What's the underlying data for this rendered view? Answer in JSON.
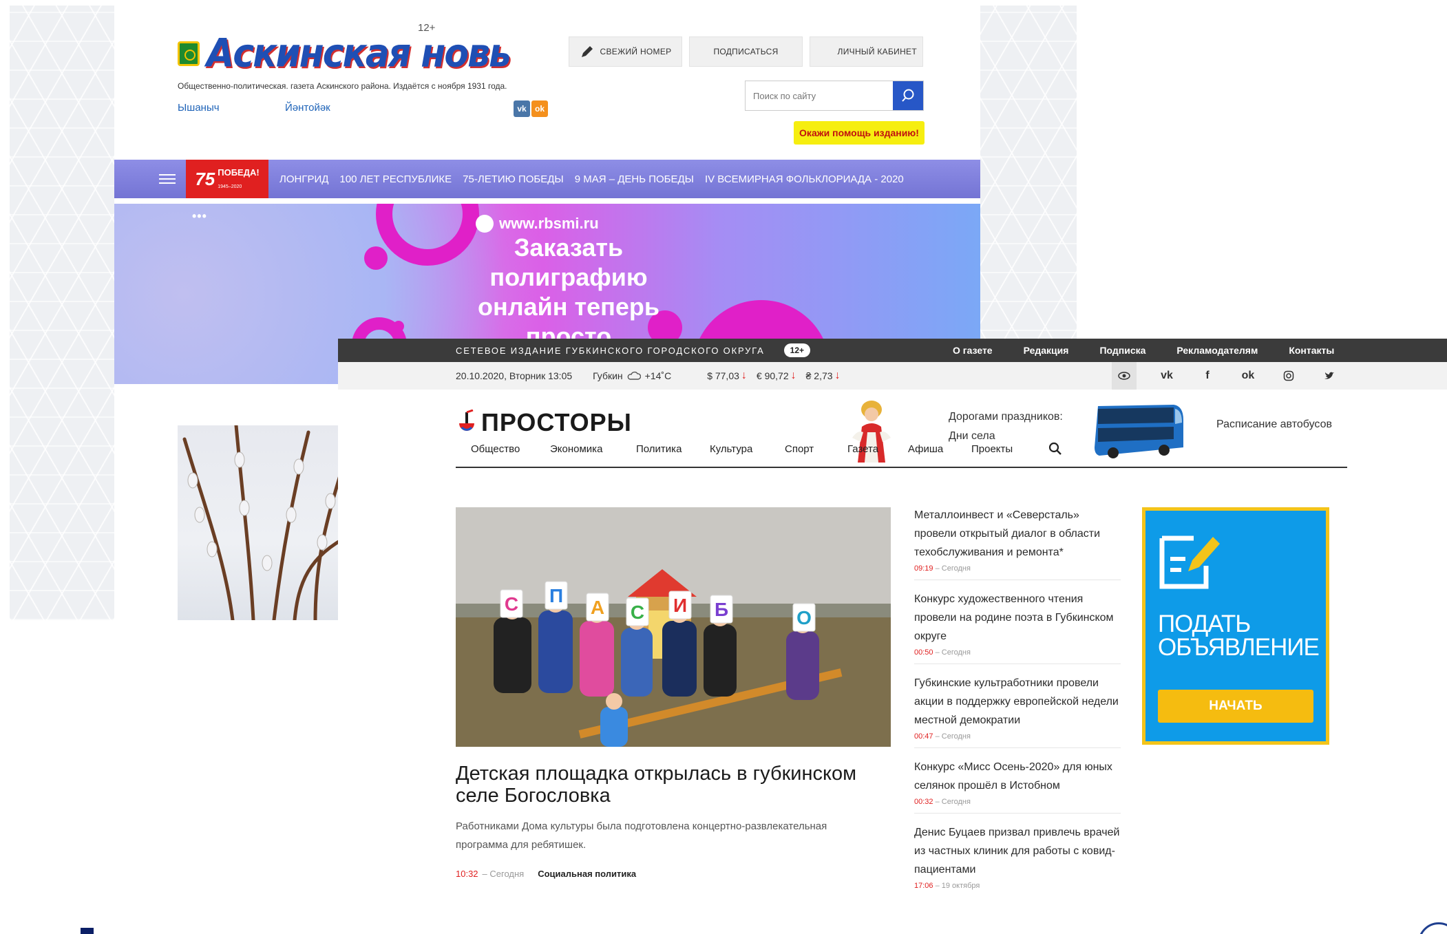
{
  "askinskaya": {
    "logo": "Аскинская новь",
    "age": "12+",
    "tagline": "Общественно-политическая. газета Аскинского района. Издаётся с ноября 1931 года.",
    "links": [
      "Ышаныч",
      "Йәнтойәк"
    ],
    "social": {
      "vk": "vk",
      "ok": "ok"
    },
    "buttons": {
      "fresh": "СВЕЖИЙ НОМЕР",
      "subscribe": "ПОДПИСАТЬСЯ",
      "cabinet": "ЛИЧНЫЙ КАБИНЕТ"
    },
    "search": {
      "placeholder": "Поиск по сайту"
    },
    "help": "Окажи помощь изданию!",
    "nav": {
      "pobeda": "ПОБЕДА!",
      "pobeda_number": "75",
      "pobeda_years": "1945–2020",
      "items": [
        "ЛОНГРИД",
        "100 ЛЕТ РЕСПУБЛИКЕ",
        "75-ЛЕТИЮ ПОБЕДЫ",
        "9 МАЯ – ДЕНЬ ПОБЕДЫ",
        "IV ВСЕМИРНАЯ ФОЛЬКЛОРИАДА - 2020"
      ]
    },
    "banner": {
      "dots": "•••",
      "url": "www.rbsmi.ru",
      "lines": [
        "Заказать",
        "полиграфию",
        "онлайн теперь",
        "просто"
      ]
    }
  },
  "prostory": {
    "top": {
      "edition": "СЕТЕВОЕ ИЗДАНИЕ ГУБКИНСКОГО ГОРОДСКОГО ОКРУГА",
      "age": "12+",
      "links": [
        "О газете",
        "Редакция",
        "Подписка",
        "Рекламодателям",
        "Контакты"
      ]
    },
    "info": {
      "date": "20.10.2020, Вторник 13:05",
      "city": "Губкин",
      "temp": "+14˚С",
      "rates": [
        "$ 77,03",
        "€ 90,72",
        "₴ 2,73"
      ]
    },
    "logo": "ПРОСТОРЫ",
    "holiday": {
      "line1": "Дорогами праздников:",
      "line2": "Дни села"
    },
    "bus": "Расписание автобусов",
    "nav": [
      "Общество",
      "Экономика",
      "Политика",
      "Культура",
      "Спорт",
      "Газета",
      "Афиша",
      "Проекты"
    ],
    "hero": {
      "headline": "Детская площадка открылась в губкинском селе Богословка",
      "lead": "Работниками Дома культуры была подготовлена концертно-развлекательная программа для ребятишек.",
      "time": "10:32",
      "when": "– Сегодня",
      "rubric": "Социальная политика",
      "letters": [
        "С",
        "П",
        "А",
        "С",
        "И",
        "Б",
        "О"
      ]
    },
    "news": [
      {
        "title": "Металлоинвест и «Северсталь» провели открытый диалог в области техобслуживания и ремонта*",
        "time": "09:19",
        "when": "– Сегодня"
      },
      {
        "title": "Конкурс художественного чтения провели на родине поэта в Губкинском округе",
        "time": "00:50",
        "when": "– Сегодня"
      },
      {
        "title": "Губкинские культработники провели акции в поддержку европейской недели местной демократии",
        "time": "00:47",
        "when": "– Сегодня"
      },
      {
        "title": "Конкурс «Мисс Осень-2020» для юных селянок прошёл в Истобном",
        "time": "00:32",
        "when": "– Сегодня"
      },
      {
        "title": "Денис Буцаев призвал привлечь врачей из частных клиник для работы с ковид-пациентами",
        "time": "17:06",
        "when": "– 19 октября"
      }
    ],
    "ad": {
      "title_line1": "ПОДАТЬ",
      "title_line2": "ОБЪЯВЛЕНИЕ",
      "button": "НАЧАТЬ"
    }
  }
}
